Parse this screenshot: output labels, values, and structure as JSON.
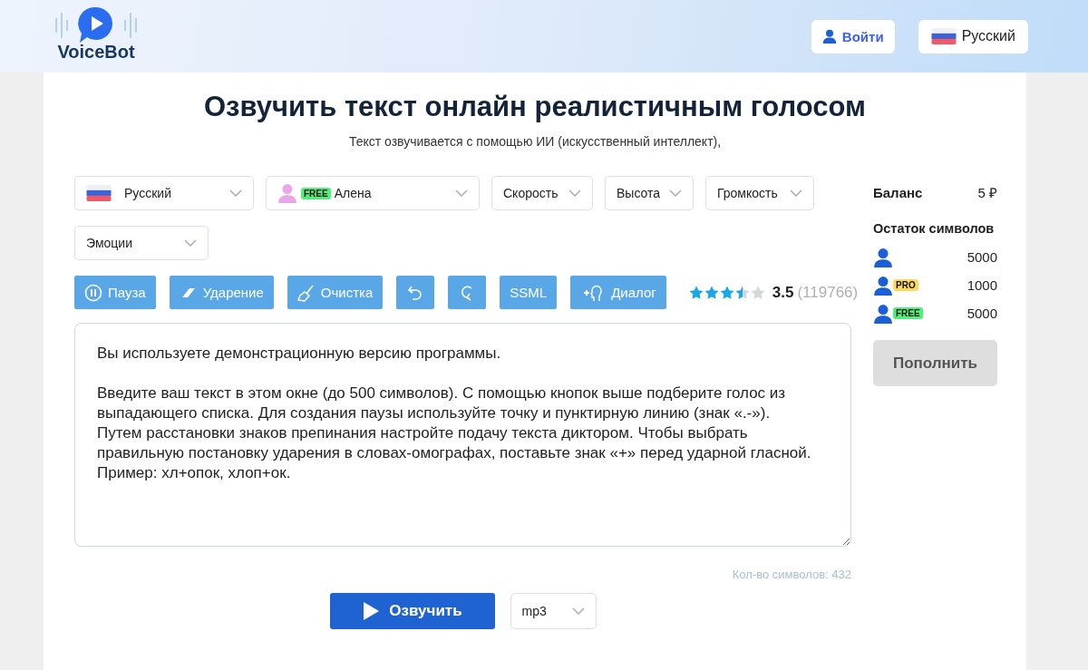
{
  "header": {
    "logo": "VoiceBot",
    "login": "Войти",
    "language": "Русский"
  },
  "title": "Озвучить текст онлайн реалистичным голосом",
  "subtitle": "Текст озвучивается с помощью ИИ (искусственный интеллект),",
  "selects": [
    {
      "kind": "flag",
      "label": "Русский"
    },
    {
      "kind": "voice",
      "badge": "FREE",
      "label": "Алена"
    },
    {
      "kind": "plain",
      "label": "Скорость"
    },
    {
      "kind": "plain",
      "label": "Высота"
    },
    {
      "kind": "plain",
      "label": "Громкость"
    },
    {
      "kind": "plain",
      "label": "Эмоции"
    }
  ],
  "tools": [
    {
      "kind": "pause",
      "label": "Пауза"
    },
    {
      "kind": "accent",
      "label": "Ударение"
    },
    {
      "kind": "clear",
      "label": "Очистка"
    },
    {
      "kind": "undo"
    },
    {
      "kind": "redo"
    },
    {
      "kind": "text",
      "label": "SSML"
    },
    {
      "kind": "dialog",
      "label": "Диалог"
    }
  ],
  "rating": {
    "stars": 3.5,
    "score": "3.5",
    "count": "(119766)"
  },
  "editor": {
    "value": "Вы используете демонстрационную версию программы.\n\nВведите ваш текст в этом окне (до 500 символов). С помощью кнопок выше подберите голос из выпадающего списка. Для создания паузы используйте точку и пунктирную линию (знак «.-»).\nПутем расстановки знаков препинания настройте подачу текста диктором. Чтобы выбрать правильную постановку ударения в словах-омографах, поставьте знак «+» перед ударной гласной. Пример: хл+опок, хлоп+ок.",
    "counter": "Кол-во символов: 432"
  },
  "play": "Озвучить",
  "format": "mp3",
  "sidebar": {
    "balance_label": "Баланс",
    "balance": "5 ₽",
    "remaining_label": "Остаток символов",
    "rows": [
      {
        "count": "5000"
      },
      {
        "badge": "PRO",
        "color": "#ffd95c",
        "count": "1000"
      },
      {
        "badge": "FREE",
        "color": "#4ef07a",
        "count": "5000"
      }
    ],
    "topup": "Пополнить"
  }
}
